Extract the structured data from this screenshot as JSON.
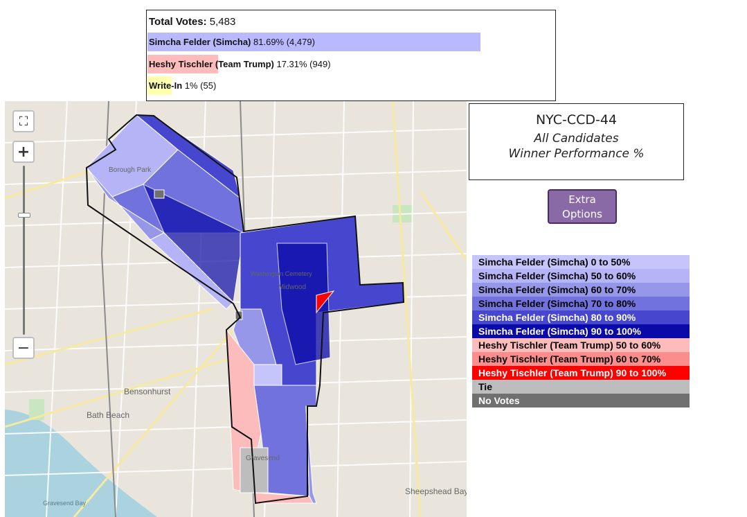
{
  "results": {
    "total_label": "Total Votes:",
    "total_value": "5,483",
    "candidates": [
      {
        "name": "Simcha Felder (Simcha)",
        "stats": "81.69% (4,479)",
        "share": 0.8169,
        "color": "#b9b9ff"
      },
      {
        "name": "Heshy Tischler (Team Trump)",
        "stats": "17.31% (949)",
        "share": 0.1731,
        "color": "#ffbcbc"
      },
      {
        "name": "Write-In",
        "stats": "1% (55)",
        "share": 0.01,
        "color": "#ffffb0"
      }
    ]
  },
  "map": {
    "controls": {
      "fullscreen_icon": "fullscreen-icon",
      "zoom_in": "+",
      "zoom_out": "−"
    },
    "labels": {
      "borough_park": "Borough Park",
      "bensonhurst": "Bensonhurst",
      "bath_beach": "Bath Beach",
      "midwood": "Midwood",
      "washington_cemetery": "Washington Cemetery",
      "sheepshead_bay": "Sheepshead Bay",
      "gravesend_bay": "Gravesend Bay",
      "gravesend": "Gravesend"
    }
  },
  "title_box": {
    "line1": "NYC-CCD-44",
    "line2": "All Candidates",
    "line3": "Winner Performance %"
  },
  "extra_options": {
    "label_line1": "Extra",
    "label_line2": "Options"
  },
  "legend": [
    {
      "label": "Simcha Felder (Simcha) 0 to 50%",
      "bg": "#c5c5fb",
      "fg": "#000000"
    },
    {
      "label": "Simcha Felder (Simcha) 50 to 60%",
      "bg": "#b4b4f6",
      "fg": "#000000"
    },
    {
      "label": "Simcha Felder (Simcha) 60 to 70%",
      "bg": "#9797ea",
      "fg": "#000000"
    },
    {
      "label": "Simcha Felder (Simcha) 70 to 80%",
      "bg": "#7272de",
      "fg": "#000000"
    },
    {
      "label": "Simcha Felder (Simcha) 80 to 90%",
      "bg": "#4646cf",
      "fg": "#ffffff"
    },
    {
      "label": "Simcha Felder (Simcha) 90 to 100%",
      "bg": "#0a0aa8",
      "fg": "#ffffff"
    },
    {
      "label": "Heshy Tischler (Team Trump) 50 to 60%",
      "bg": "#fdbcbc",
      "fg": "#000000"
    },
    {
      "label": "Heshy Tischler (Team Trump) 60 to 70%",
      "bg": "#fb8d8d",
      "fg": "#000000"
    },
    {
      "label": "Heshy Tischler (Team Trump) 90 to 100%",
      "bg": "#ff0000",
      "fg": "#ffffff"
    },
    {
      "label": "Tie",
      "bg": "#bdbdbd",
      "fg": "#000000"
    },
    {
      "label": "No Votes",
      "bg": "#707070",
      "fg": "#ffffff"
    }
  ]
}
